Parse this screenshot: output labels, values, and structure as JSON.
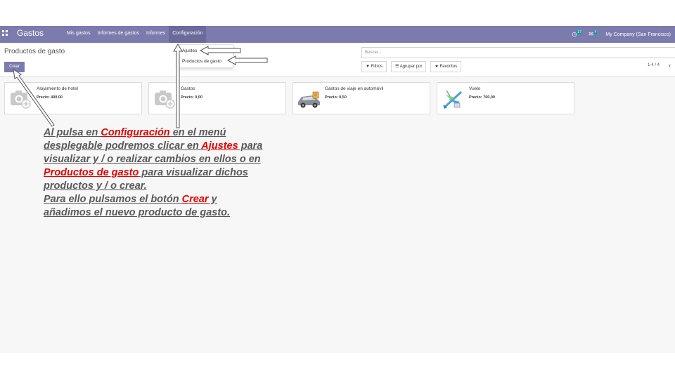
{
  "navbar": {
    "brand": "Gastos",
    "menu": [
      "Mis gastos",
      "Informes de gastos",
      "Informes",
      "Configuración"
    ],
    "activity_count": "17",
    "messages_count": "4",
    "company": "My Company (San Francisco)"
  },
  "control_panel": {
    "breadcrumb": "Productos de gasto",
    "create_label": "Crear",
    "search_placeholder": "Buscar...",
    "filters_label": "Filtros",
    "group_by_label": "Agrupar por",
    "favorites_label": "Favoritos",
    "pager": "1-4 / 4"
  },
  "dropdown": {
    "items": [
      "Ajustes",
      "Productos de gasto"
    ]
  },
  "products": [
    {
      "name": "Alojamiento de hotel",
      "price": "Precio: 400,00",
      "image": "camera-placeholder-icon"
    },
    {
      "name": "Gastos",
      "price": "Precio: 0,00",
      "image": "camera-placeholder-icon"
    },
    {
      "name": "Gastos de viaje en automóvil",
      "price": "Precio: 0,50",
      "image": "car-icon"
    },
    {
      "name": "Vuelo",
      "price": "Precio: 700,00",
      "image": "airplane-icon"
    }
  ],
  "annotation": {
    "p1": "Al pulsa en ",
    "p2": "Configuración",
    "p3": " en el menú",
    "p4": "desplegable podremos clicar en ",
    "p5": "Ajustes",
    "p6": " para",
    "p7": "visualizar y / o realizar cambios en ellos o en",
    "p8": "Productos de gasto",
    "p9": " para visualizar dichos",
    "p10": "productos y / o crear.",
    "p11": "Para ello pulsamos el botón ",
    "p12": "Crear",
    "p13": " y",
    "p14": "añadimos el nuevo producto de gasto."
  },
  "colors": {
    "primary": "#7c7bad",
    "highlight": "#e00000",
    "annotation_text": "#595959"
  }
}
